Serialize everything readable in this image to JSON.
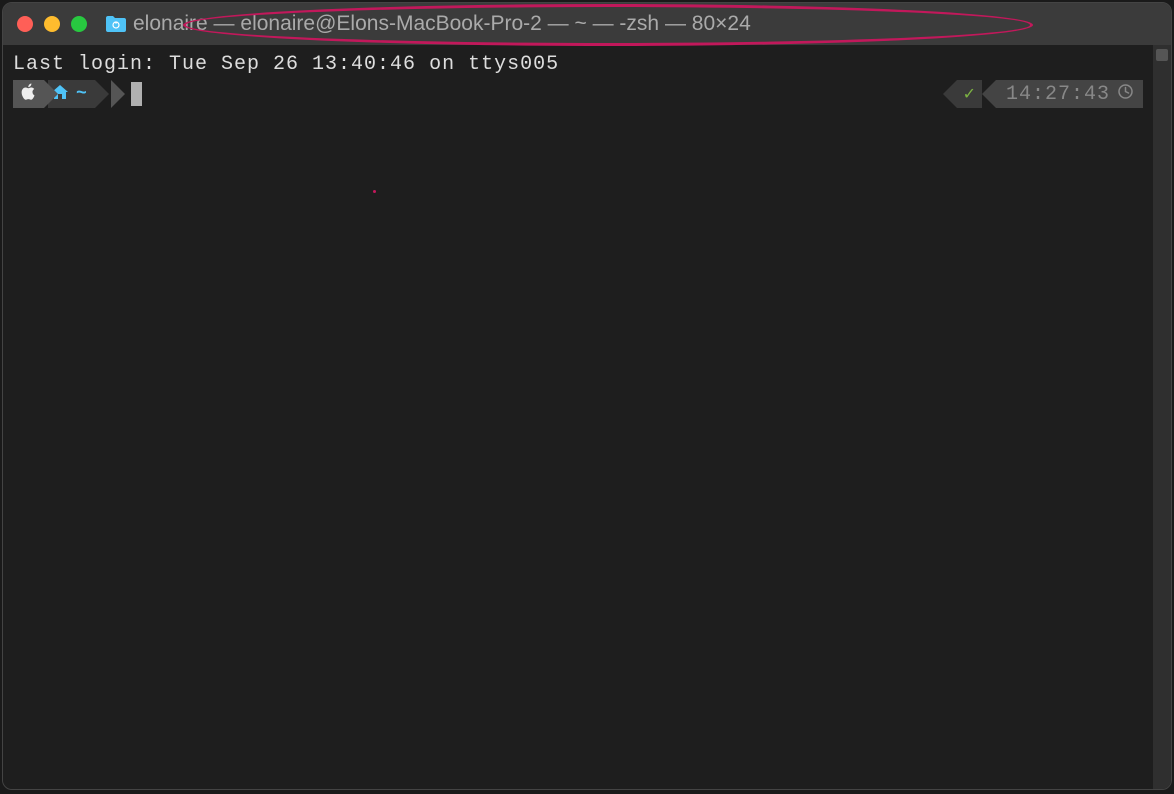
{
  "window": {
    "title": "elonaire — elonaire@Elons-MacBook-Pro-2 — ~ — -zsh — 80×24"
  },
  "terminal": {
    "last_login": "Last login: Tue Sep 26 13:40:46 on ttys005",
    "prompt": {
      "home_symbol": "~"
    },
    "right_status": {
      "check": "✓",
      "time": "14:27:43"
    }
  }
}
